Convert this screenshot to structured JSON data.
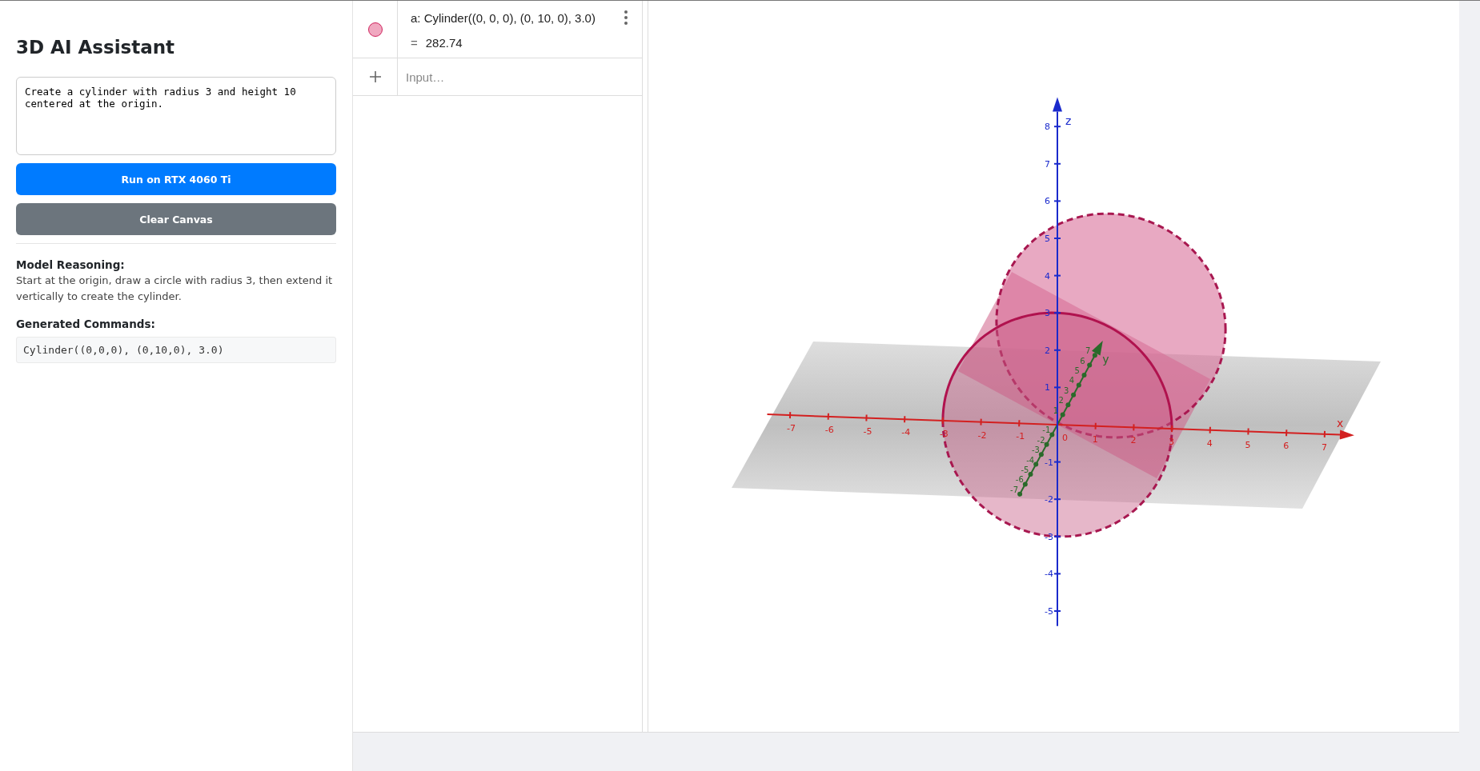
{
  "sidebar": {
    "title": "3D AI Assistant",
    "prompt": "Create a cylinder with radius 3 and height 10 centered at the origin.",
    "buttons": [
      {
        "label": "Run on RTX 4060 Ti",
        "kind": "primary"
      },
      {
        "label": "Clear Canvas",
        "kind": "secondary"
      }
    ],
    "reasoning_heading": "Model Reasoning:",
    "reasoning": "Start at the origin, draw a circle with radius 3, then extend it vertically to create the cylinder.",
    "commands_heading": "Generated Commands:",
    "commands": "Cylinder((0,0,0), (0,10,0), 3.0)"
  },
  "algebra": {
    "items": [
      {
        "definition": "a: Cylinder((0, 0, 0), (0, 10, 0), 3.0)",
        "equals": "=",
        "value": "282.74",
        "visible": true
      }
    ],
    "input_placeholder": "Input…"
  },
  "graphics": {
    "axes": [
      {
        "kind": "x",
        "name": "x",
        "ticks": [
          "-7",
          "-6",
          "-5",
          "-4",
          "-3",
          "-2",
          "-1",
          "0",
          "1",
          "2",
          "3",
          "4",
          "5",
          "6",
          "7"
        ]
      },
      {
        "kind": "y",
        "name": "y",
        "ticks": [
          "7",
          "6",
          "5",
          "4",
          "3",
          "2",
          "1",
          "-1",
          "-2",
          "-3",
          "-4",
          "-5",
          "-6",
          "-7"
        ]
      },
      {
        "kind": "z",
        "name": "z",
        "ticks": [
          "8",
          "7",
          "6",
          "5",
          "4",
          "3",
          "2",
          "1",
          "-1",
          "-2",
          "-3",
          "-4",
          "-5"
        ]
      }
    ]
  }
}
